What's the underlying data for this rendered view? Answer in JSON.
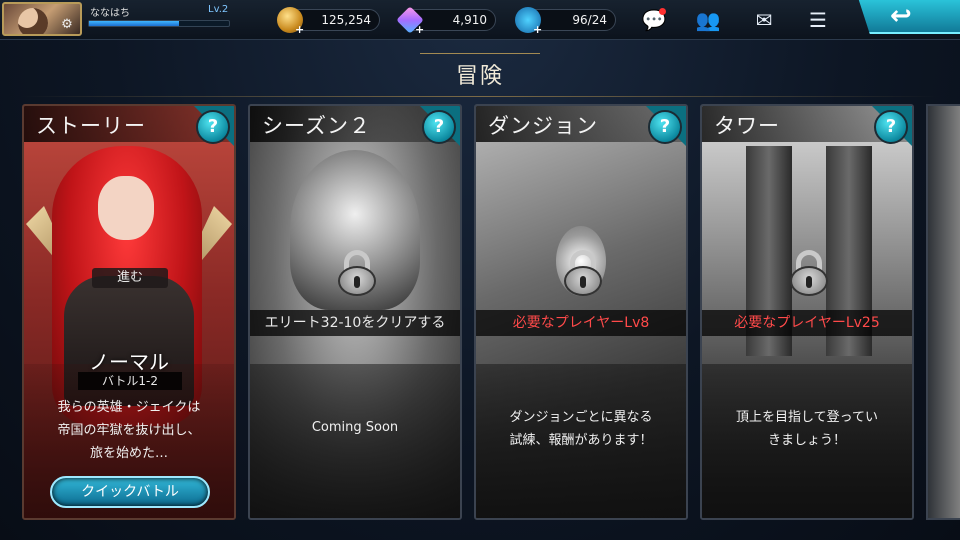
{
  "player": {
    "name": "ななはち",
    "level": "Lv.2",
    "xp_fraction": 0.64
  },
  "resources": {
    "gold": "125,254",
    "gems": "4,910",
    "stamina": "96/24"
  },
  "header": {
    "title": "冒険"
  },
  "cards": [
    {
      "id": "story",
      "name": "ストーリー",
      "help": "?",
      "advance_label": "進む",
      "mode": "ノーマル",
      "battle": "バトル1-2",
      "desc": [
        "我らの英雄・ジェイクは",
        "帝国の牢獄を抜け出し、",
        "旅を始めた…"
      ],
      "button": "クイックバトル"
    },
    {
      "id": "season2",
      "name": "シーズン２",
      "help": "?",
      "requirement": "エリート32-10をクリアする",
      "desc": [
        "Coming Soon"
      ]
    },
    {
      "id": "dungeon",
      "name": "ダンジョン",
      "help": "?",
      "requirement": "必要なプレイヤーLv8",
      "desc": [
        "ダンジョンごとに異なる",
        "試練、報酬があります！"
      ]
    },
    {
      "id": "tower",
      "name": "タワー",
      "help": "?",
      "requirement": "必要なプレイヤーLv25",
      "desc": [
        "頂上を目指して登ってい",
        "きましょう！"
      ]
    }
  ],
  "icons": {
    "settings": "gear-icon",
    "chat": "chat-icon",
    "friends": "friends-icon",
    "mail": "mail-icon",
    "menu": "menu-icon",
    "back": "back-arrow-icon"
  },
  "colors": {
    "accent": "#1aa9c4",
    "requirement": "#ff4a4a"
  }
}
